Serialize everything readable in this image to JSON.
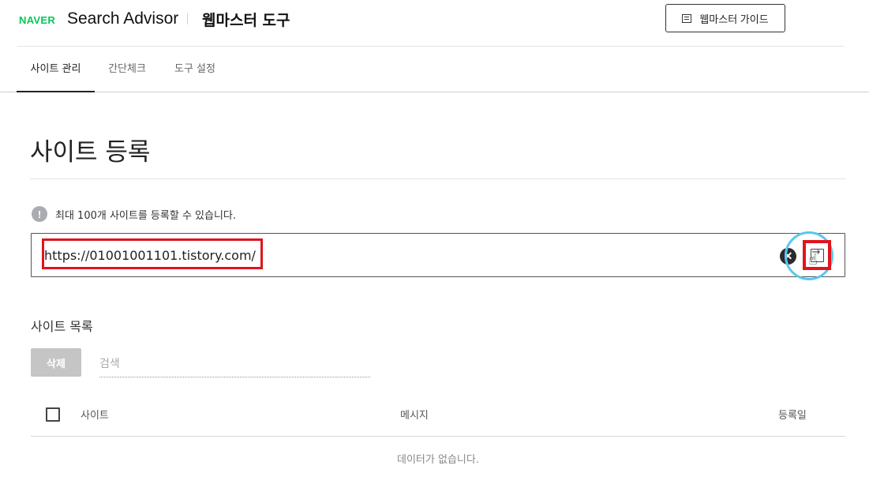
{
  "header": {
    "brand": "NAVER",
    "product": "Search Advisor",
    "section": "웹마스터 도구",
    "guide_button": "웹마스터 가이드",
    "guide_icon": "book-list-icon"
  },
  "tabs": [
    {
      "label": "사이트 관리",
      "active": true
    },
    {
      "label": "간단체크",
      "active": false
    },
    {
      "label": "도구 설정",
      "active": false
    }
  ],
  "main": {
    "title": "사이트 등록",
    "notice": "최대 100개 사이트를 등록할 수 있습니다.",
    "notice_icon_glyph": "!",
    "url_input": {
      "value": "https://01001001101.tistory.com/",
      "placeholder": ""
    },
    "clear_glyph": "✕",
    "cursor_glyph": "☝"
  },
  "site_list": {
    "title": "사이트 목록",
    "delete_button": "삭제",
    "search_placeholder": "검색",
    "columns": {
      "site": "사이트",
      "message": "메시지",
      "registered": "등록일"
    },
    "empty_text": "데이터가 없습니다."
  },
  "colors": {
    "brand_green": "#03c75a",
    "highlight_red": "#e1141c",
    "click_ring": "#5bc6ef"
  }
}
